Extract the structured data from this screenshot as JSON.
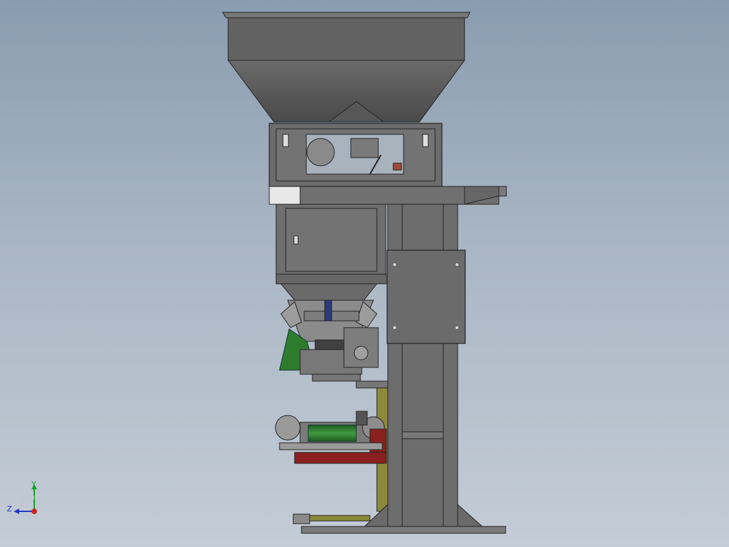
{
  "viewport": {
    "background_top": "#8a9cb0",
    "background_bottom": "#c4ccd6"
  },
  "triad": {
    "y_label": "Y",
    "z_label": "Z",
    "y_color": "#17a02a",
    "z_color": "#2236c8",
    "origin_color": "#c82020"
  },
  "model": {
    "icon": "packing-machine-cad-model",
    "body_color": "#6f6f6f",
    "hopper_color": "#5c5c5c",
    "accent_green": "#2e7d2e",
    "accent_red": "#8a2020",
    "accent_olive": "#8a8a3a"
  }
}
